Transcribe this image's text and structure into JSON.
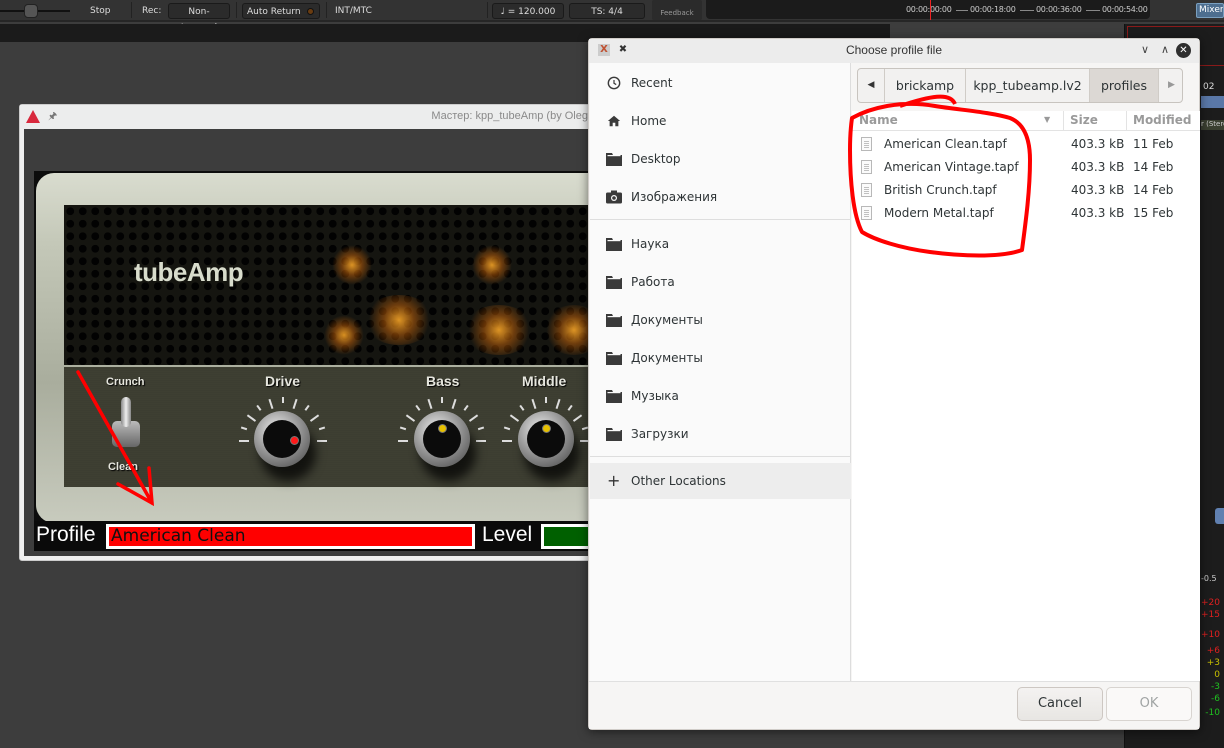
{
  "toolbar": {
    "transport_state": "Stop",
    "rec_label": "Rec:",
    "rec_mode": "Non-Layered",
    "auto_return": "Auto Return",
    "sync": "INT/MTC",
    "tempo": "♩ = 120.000",
    "time_signature": "TS: 4/4",
    "feedback": "Feedback",
    "mixer": "Mixer",
    "timeline_marks": [
      "00:00:00:00",
      "00:00:18:00",
      "00:00:36:00",
      "00:00:54:00"
    ]
  },
  "mixer_strip": {
    "track_id": "02",
    "track_name": "r (Stere",
    "gain": "-0.5",
    "meter_scale": [
      "+20",
      "+15",
      "+10",
      "+6",
      "+3",
      "0",
      "-3",
      "-6",
      "-10"
    ],
    "meter_colors": {
      "red": "#e02020",
      "yellow": "#c8c000",
      "green": "#20c020"
    }
  },
  "plugin_window": {
    "title": "Мастер: kpp_tubeAmp (by Oleg",
    "amp_name": "tubeAmp",
    "toggle_top": "Crunch",
    "toggle_bottom": "Clean",
    "knobs": [
      {
        "label": "Drive",
        "indicator": "red"
      },
      {
        "label": "Bass",
        "indicator": "yellow"
      },
      {
        "label": "Middle",
        "indicator": "yellow"
      }
    ],
    "profile_label": "Profile",
    "profile_value": "American Clean",
    "level_label": "Level",
    "colors": {
      "profile_bg": "#ff0000",
      "level_bg": "#006000"
    }
  },
  "file_dialog": {
    "title": "Choose profile file",
    "sidebar": {
      "places": [
        {
          "label": "Recent",
          "icon": "clock-icon"
        },
        {
          "label": "Home",
          "icon": "home-icon"
        },
        {
          "label": "Desktop",
          "icon": "folder-icon"
        },
        {
          "label": "Изображения",
          "icon": "camera-icon"
        }
      ],
      "bookmarks": [
        {
          "label": "Наука",
          "icon": "folder-icon"
        },
        {
          "label": "Работа",
          "icon": "folder-icon"
        },
        {
          "label": "Документы",
          "icon": "folder-icon"
        },
        {
          "label": "Документы",
          "icon": "folder-icon"
        },
        {
          "label": "Музыка",
          "icon": "folder-icon"
        },
        {
          "label": "Загрузки",
          "icon": "folder-icon"
        }
      ],
      "other_locations": "Other Locations"
    },
    "path": [
      "brickamp",
      "kpp_tubeamp.lv2",
      "profiles"
    ],
    "columns": {
      "name": "Name",
      "size": "Size",
      "modified": "Modified"
    },
    "files": [
      {
        "name": "American Clean.tapf",
        "size": "403.3 kB",
        "modified": "11 Feb"
      },
      {
        "name": "American Vintage.tapf",
        "size": "403.3 kB",
        "modified": "14 Feb"
      },
      {
        "name": "British Crunch.tapf",
        "size": "403.3 kB",
        "modified": "14 Feb"
      },
      {
        "name": "Modern Metal.tapf",
        "size": "403.3 kB",
        "modified": "15 Feb"
      }
    ],
    "cancel_label": "Cancel",
    "ok_label": "OK"
  },
  "annotation_color": "#ff0000"
}
